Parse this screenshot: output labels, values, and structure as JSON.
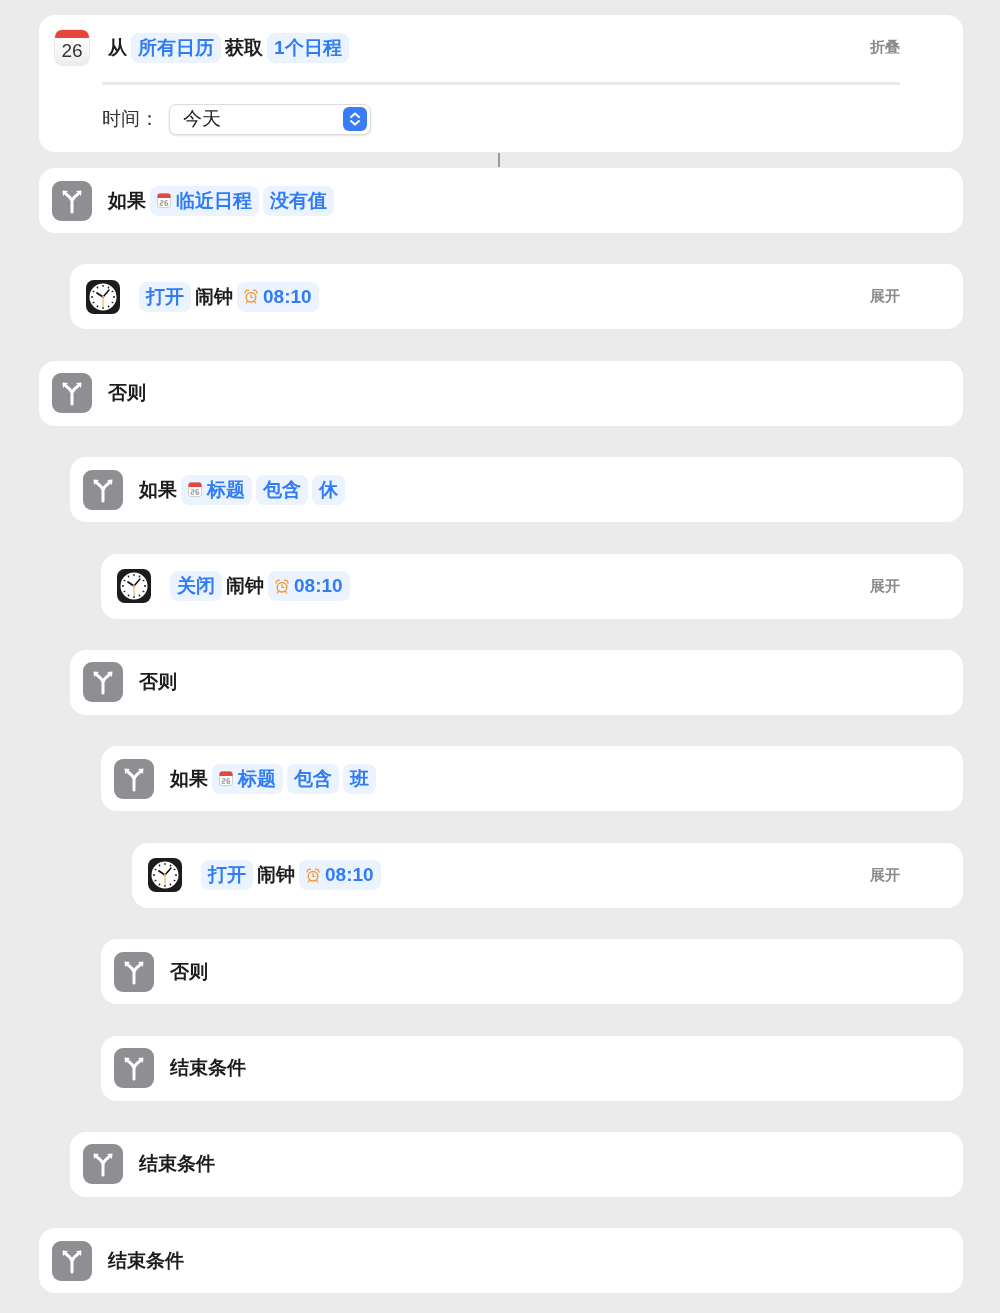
{
  "actions": [
    {
      "kind": "get_events",
      "calendar_day": "26",
      "tokens": [
        {
          "kind": "word",
          "text": "从"
        },
        {
          "kind": "param",
          "text": "所有日历"
        },
        {
          "kind": "word",
          "text": "获取"
        },
        {
          "kind": "param",
          "text": "1个日程"
        }
      ],
      "toggle": "折叠",
      "field": {
        "label": "时间：",
        "value": "今天"
      }
    },
    {
      "kind": "condition",
      "tokens": [
        {
          "kind": "word",
          "text": "如果"
        },
        {
          "kind": "calendar_variable",
          "text": "临近日程"
        },
        {
          "kind": "param",
          "text": "没有值"
        }
      ],
      "children": [
        {
          "kind": "set_alarm",
          "tokens": [
            {
              "kind": "param",
              "text": "打开"
            },
            {
              "kind": "word",
              "text": "闹钟"
            },
            {
              "kind": "alarm_variable",
              "text": "08:10"
            }
          ],
          "toggle": "展开"
        }
      ]
    },
    {
      "kind": "condition",
      "tokens": [
        {
          "kind": "word",
          "text": "否则"
        }
      ],
      "children": [
        {
          "kind": "condition",
          "tokens": [
            {
              "kind": "word",
              "text": "如果"
            },
            {
              "kind": "calendar_variable",
              "text": "标题"
            },
            {
              "kind": "param",
              "text": "包含"
            },
            {
              "kind": "param",
              "text": "休"
            }
          ],
          "children": [
            {
              "kind": "set_alarm",
              "tokens": [
                {
                  "kind": "param",
                  "text": "关闭"
                },
                {
                  "kind": "word",
                  "text": "闹钟"
                },
                {
                  "kind": "alarm_variable",
                  "text": "08:10"
                }
              ],
              "toggle": "展开"
            }
          ]
        },
        {
          "kind": "condition",
          "tokens": [
            {
              "kind": "word",
              "text": "否则"
            }
          ],
          "children": [
            {
              "kind": "condition",
              "tokens": [
                {
                  "kind": "word",
                  "text": "如果"
                },
                {
                  "kind": "calendar_variable",
                  "text": "标题"
                },
                {
                  "kind": "param",
                  "text": "包含"
                },
                {
                  "kind": "param",
                  "text": "班"
                }
              ],
              "children": [
                {
                  "kind": "set_alarm",
                  "tokens": [
                    {
                      "kind": "param",
                      "text": "打开"
                    },
                    {
                      "kind": "word",
                      "text": "闹钟"
                    },
                    {
                      "kind": "alarm_variable",
                      "text": "08:10"
                    }
                  ],
                  "toggle": "展开"
                }
              ]
            },
            {
              "kind": "condition",
              "tokens": [
                {
                  "kind": "word",
                  "text": "否则"
                }
              ]
            },
            {
              "kind": "condition",
              "tokens": [
                {
                  "kind": "word",
                  "text": "结束条件"
                }
              ]
            }
          ]
        },
        {
          "kind": "condition",
          "tokens": [
            {
              "kind": "word",
              "text": "结束条件"
            }
          ]
        }
      ]
    },
    {
      "kind": "condition",
      "tokens": [
        {
          "kind": "word",
          "text": "结束条件"
        }
      ]
    }
  ]
}
